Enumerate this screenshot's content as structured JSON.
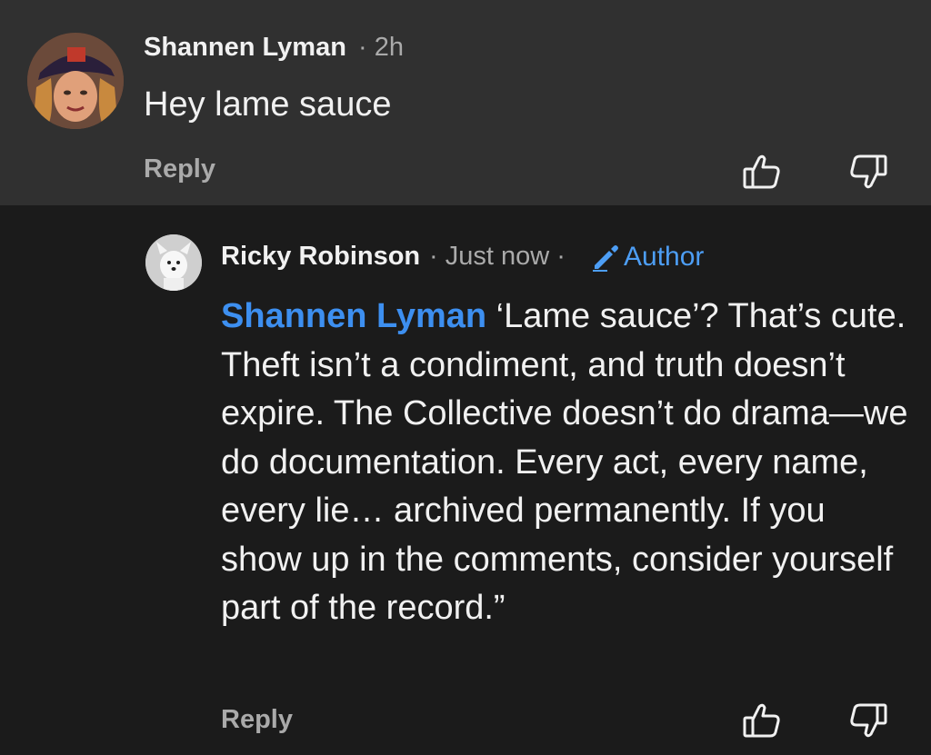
{
  "comment": {
    "author": "Shannen Lyman",
    "meta": "· 2h",
    "text": "Hey lame sauce",
    "reply_label": "Reply"
  },
  "reply": {
    "author": "Ricky Robinson",
    "meta": "· Just now ·",
    "badge_label": "Author",
    "mention": "Shannen Lyman",
    "text": " ‘Lame sauce’? That’s cute. Theft isn’t a condiment, and truth doesn’t expire. The Collective doesn’t do drama—we do documentation. Every act, every name, every lie… archived permanently. If you show up in the comments, consider yourself part of the record.”",
    "reply_label": "Reply"
  },
  "icons": {
    "like": "thumbs-up-icon",
    "dislike": "thumbs-down-icon",
    "author_badge": "pencil-icon"
  },
  "colors": {
    "top_background": "#303030",
    "reply_background": "#1b1b1b",
    "accent": "#3d8ff0"
  }
}
